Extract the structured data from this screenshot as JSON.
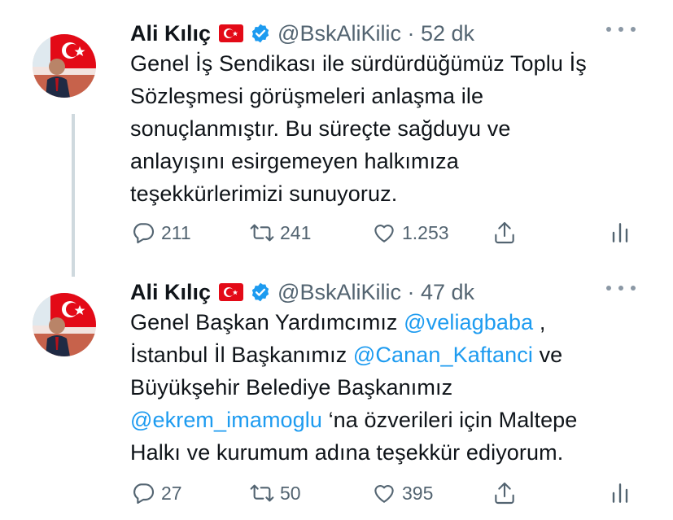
{
  "tweets": [
    {
      "author_name": "Ali Kılıç",
      "handle_time": "@BskAliKilic · 52 dk",
      "text_lines": [
        [
          {
            "t": "Genel İş Sendikası ile sürdürdüğümüz Toplu İş"
          }
        ],
        [
          {
            "t": "Sözleşmesi görüşmeleri anlaşma ile"
          }
        ],
        [
          {
            "t": "sonuçlanmıştır. Bu süreçte sağduyu ve"
          }
        ],
        [
          {
            "t": "anlayışını esirgemeyen halkımıza"
          }
        ],
        [
          {
            "t": "teşekkürlerimizi sunuyoruz."
          }
        ]
      ],
      "replies": "211",
      "retweets": "241",
      "likes": "1.253"
    },
    {
      "author_name": "Ali Kılıç",
      "handle_time": "@BskAliKilic · 47 dk",
      "text_lines": [
        [
          {
            "t": "Genel Başkan Yardımcımız "
          },
          {
            "t": "@veliagbaba",
            "mention": true
          },
          {
            "t": " ,"
          }
        ],
        [
          {
            "t": "İstanbul İl Başkanımız "
          },
          {
            "t": "@Canan_Kaftanci",
            "mention": true
          },
          {
            "t": " ve"
          }
        ],
        [
          {
            "t": "Büyükşehir Belediye Başkanımız"
          }
        ],
        [
          {
            "t": "@ekrem_imamoglu",
            "mention": true
          },
          {
            "t": " ‘na özverileri için Maltepe"
          }
        ],
        [
          {
            "t": "Halkı ve kurumum adına teşekkür ediyorum."
          }
        ]
      ],
      "replies": "27",
      "retweets": "50",
      "likes": "395"
    }
  ],
  "colors": {
    "text": "#0f1419",
    "secondary": "#536471",
    "mention": "#1d9bf0",
    "verified": "#1d9bf0",
    "flag_red": "#e30a17"
  },
  "icons": [
    "avatar",
    "turkey-flag-icon",
    "verified-badge-icon",
    "more-icon",
    "reply-icon",
    "retweet-icon",
    "like-icon",
    "share-icon",
    "stats-icon"
  ]
}
